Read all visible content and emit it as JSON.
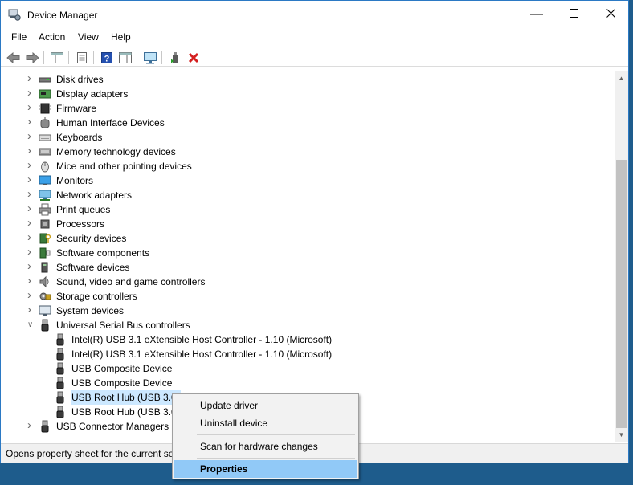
{
  "window": {
    "title": "Device Manager"
  },
  "menu": [
    "File",
    "Action",
    "View",
    "Help"
  ],
  "tree": {
    "collapsed_categories": [
      {
        "label": "Disk drives",
        "icon": "disk-drive-icon"
      },
      {
        "label": "Display adapters",
        "icon": "display-adapter-icon"
      },
      {
        "label": "Firmware",
        "icon": "firmware-icon"
      },
      {
        "label": "Human Interface Devices",
        "icon": "hid-icon"
      },
      {
        "label": "Keyboards",
        "icon": "keyboard-icon"
      },
      {
        "label": "Memory technology devices",
        "icon": "memory-icon"
      },
      {
        "label": "Mice and other pointing devices",
        "icon": "mouse-icon"
      },
      {
        "label": "Monitors",
        "icon": "monitor-icon"
      },
      {
        "label": "Network adapters",
        "icon": "network-adapter-icon"
      },
      {
        "label": "Print queues",
        "icon": "printer-icon"
      },
      {
        "label": "Processors",
        "icon": "processor-icon"
      },
      {
        "label": "Security devices",
        "icon": "security-device-icon"
      },
      {
        "label": "Software components",
        "icon": "software-component-icon"
      },
      {
        "label": "Software devices",
        "icon": "software-device-icon"
      },
      {
        "label": "Sound, video and game controllers",
        "icon": "speaker-icon"
      },
      {
        "label": "Storage controllers",
        "icon": "storage-controller-icon"
      },
      {
        "label": "System devices",
        "icon": "system-device-icon"
      }
    ],
    "expanded_category": {
      "label": "Universal Serial Bus controllers",
      "icon": "usb-icon"
    },
    "usb_children": [
      {
        "label": "Intel(R) USB 3.1 eXtensible Host Controller - 1.10 (Microsoft)",
        "selected": false
      },
      {
        "label": "Intel(R) USB 3.1 eXtensible Host Controller - 1.10 (Microsoft)",
        "selected": false
      },
      {
        "label": "USB Composite Device",
        "selected": false
      },
      {
        "label": "USB Composite Device",
        "selected": false
      },
      {
        "label": "USB Root Hub (USB 3.0)",
        "selected": true
      },
      {
        "label": "USB Root Hub (USB 3.0)",
        "selected": false
      }
    ],
    "after_category": {
      "label": "USB Connector Managers",
      "icon": "usb-icon"
    }
  },
  "status": {
    "text": "Opens property sheet for the current selection."
  },
  "context_menu": {
    "update_driver": "Update driver",
    "uninstall_device": "Uninstall device",
    "scan_hardware": "Scan for hardware changes",
    "properties": "Properties"
  },
  "colors": {
    "selection": "#cce8ff",
    "menu_highlight": "#91c9f7",
    "desktop": "#1e5c8c"
  }
}
